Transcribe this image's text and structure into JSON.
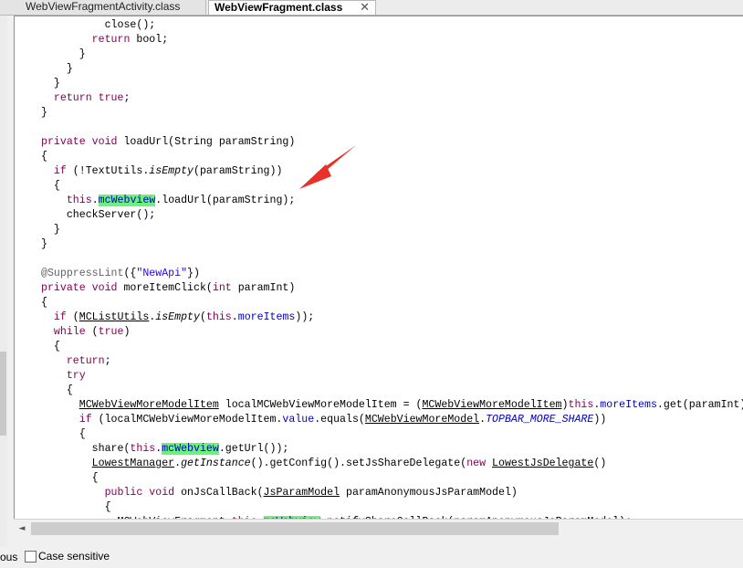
{
  "tabs": [
    {
      "label": "WebViewFragmentActivity.class",
      "active": false
    },
    {
      "label": "WebViewFragment.class",
      "active": true,
      "close": "✕"
    }
  ],
  "code_lines": [
    [
      {
        "t": "          close();"
      }
    ],
    [
      {
        "t": "        "
      },
      {
        "t": "return",
        "c": "kw"
      },
      {
        "t": " bool;"
      }
    ],
    [
      {
        "t": "      }"
      }
    ],
    [
      {
        "t": "    }"
      }
    ],
    [
      {
        "t": "  }"
      }
    ],
    [
      {
        "t": "  "
      },
      {
        "t": "return",
        "c": "kw"
      },
      {
        "t": " "
      },
      {
        "t": "true",
        "c": "kw"
      },
      {
        "t": ";"
      }
    ],
    [
      {
        "t": "}"
      }
    ],
    [
      {
        "t": ""
      }
    ],
    [
      {
        "t": "private",
        "c": "kw"
      },
      {
        "t": " "
      },
      {
        "t": "void",
        "c": "kw"
      },
      {
        "t": " loadUrl(String paramString)"
      }
    ],
    [
      {
        "t": "{"
      }
    ],
    [
      {
        "t": "  "
      },
      {
        "t": "if",
        "c": "kw"
      },
      {
        "t": " (!TextUtils."
      },
      {
        "t": "isEmpty",
        "c": "it"
      },
      {
        "t": "(paramString))"
      }
    ],
    [
      {
        "t": "  {"
      }
    ],
    [
      {
        "t": "    "
      },
      {
        "t": "this",
        "c": "kw"
      },
      {
        "t": "."
      },
      {
        "t": "mcWebview",
        "c": "fld hl"
      },
      {
        "t": ".loadUrl(paramString);"
      }
    ],
    [
      {
        "t": "    checkServer();"
      }
    ],
    [
      {
        "t": "  }"
      }
    ],
    [
      {
        "t": "}"
      }
    ],
    [
      {
        "t": ""
      }
    ],
    [
      {
        "t": "@SuppressLint",
        "c": "ann"
      },
      {
        "t": "({"
      },
      {
        "t": "\"NewApi\"",
        "c": "str"
      },
      {
        "t": "})"
      }
    ],
    [
      {
        "t": "private",
        "c": "kw"
      },
      {
        "t": " "
      },
      {
        "t": "void",
        "c": "kw"
      },
      {
        "t": " moreItemClick("
      },
      {
        "t": "int",
        "c": "kw"
      },
      {
        "t": " paramInt)"
      }
    ],
    [
      {
        "t": "{"
      }
    ],
    [
      {
        "t": "  "
      },
      {
        "t": "if",
        "c": "kw"
      },
      {
        "t": " ("
      },
      {
        "t": "MCListUtils",
        "c": "u"
      },
      {
        "t": "."
      },
      {
        "t": "isEmpty",
        "c": "it"
      },
      {
        "t": "("
      },
      {
        "t": "this",
        "c": "kw"
      },
      {
        "t": "."
      },
      {
        "t": "moreItems",
        "c": "fld"
      },
      {
        "t": "));"
      }
    ],
    [
      {
        "t": "  "
      },
      {
        "t": "while",
        "c": "kw"
      },
      {
        "t": " ("
      },
      {
        "t": "true",
        "c": "kw"
      },
      {
        "t": ")"
      }
    ],
    [
      {
        "t": "  {"
      }
    ],
    [
      {
        "t": "    "
      },
      {
        "t": "return",
        "c": "kw"
      },
      {
        "t": ";"
      }
    ],
    [
      {
        "t": "    "
      },
      {
        "t": "try",
        "c": "kw"
      }
    ],
    [
      {
        "t": "    {"
      }
    ],
    [
      {
        "t": "      "
      },
      {
        "t": "MCWebViewMoreModelItem",
        "c": "u"
      },
      {
        "t": " localMCWebViewMoreModelItem = ("
      },
      {
        "t": "MCWebViewMoreModelItem",
        "c": "u"
      },
      {
        "t": ")"
      },
      {
        "t": "this",
        "c": "kw"
      },
      {
        "t": "."
      },
      {
        "t": "moreItems",
        "c": "fld"
      },
      {
        "t": ".get(paramInt);"
      }
    ],
    [
      {
        "t": "      "
      },
      {
        "t": "if",
        "c": "kw"
      },
      {
        "t": " (localMCWebViewMoreModelItem."
      },
      {
        "t": "value",
        "c": "fld"
      },
      {
        "t": ".equals("
      },
      {
        "t": "MCWebViewMoreModel",
        "c": "u"
      },
      {
        "t": "."
      },
      {
        "t": "TOPBAR_MORE_SHARE",
        "c": "itf"
      },
      {
        "t": "))"
      }
    ],
    [
      {
        "t": "      {"
      }
    ],
    [
      {
        "t": "        share("
      },
      {
        "t": "this",
        "c": "kw"
      },
      {
        "t": "."
      },
      {
        "t": "mcWebview",
        "c": "fld hl"
      },
      {
        "t": ".getUrl());"
      }
    ],
    [
      {
        "t": "        "
      },
      {
        "t": "LowestManager",
        "c": "u"
      },
      {
        "t": "."
      },
      {
        "t": "getInstance",
        "c": "it"
      },
      {
        "t": "().getConfig().setJsShareDelegate("
      },
      {
        "t": "new",
        "c": "kw"
      },
      {
        "t": " "
      },
      {
        "t": "LowestJsDelegate",
        "c": "u"
      },
      {
        "t": "()"
      }
    ],
    [
      {
        "t": "        {"
      }
    ],
    [
      {
        "t": "          "
      },
      {
        "t": "public",
        "c": "kw"
      },
      {
        "t": " "
      },
      {
        "t": "void",
        "c": "kw"
      },
      {
        "t": " onJsCallBack("
      },
      {
        "t": "JsParamModel",
        "c": "u"
      },
      {
        "t": " paramAnonymousJsParamModel)"
      }
    ],
    [
      {
        "t": "          {"
      }
    ],
    [
      {
        "t": "            MCWebViewFragment."
      },
      {
        "t": "this",
        "c": "kw"
      },
      {
        "t": "."
      },
      {
        "t": "mcWebview",
        "c": "fld hl"
      },
      {
        "t": ".notifyShareCallBack(paramAnonymousJsParamModel);"
      }
    ]
  ],
  "scrollbar": {
    "left_arrow": "◄"
  },
  "findbar": {
    "prev_label": "ous",
    "case_sensitive_label": "Case sensitive",
    "case_sensitive_checked": false
  },
  "colors": {
    "keyword": "#7f0055",
    "string": "#2a00ff",
    "field": "#0000c0",
    "highlight": "#6bf17d",
    "arrow": "#e8312a"
  }
}
